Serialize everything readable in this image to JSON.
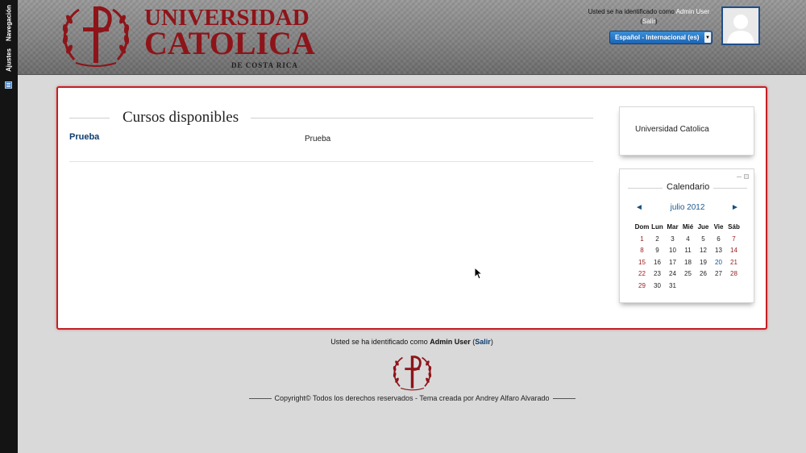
{
  "dock": {
    "nav_label": "Navegación",
    "settings_label": "Ajustes"
  },
  "header": {
    "logo_line1": "UNIVERSIDAD",
    "logo_line2": "CATOLICA",
    "logo_sub": "DE COSTA RICA",
    "login_prefix": "Usted se ha identificado como",
    "user_name": "Admin User",
    "logout_label": "Salir",
    "language": "Español - Internacional (es)"
  },
  "main": {
    "section_title": "Cursos disponibles",
    "courses": [
      {
        "name": "Prueba",
        "summary": "Prueba"
      }
    ]
  },
  "blocks": {
    "university": "Universidad Catolica",
    "calendar": {
      "title": "Calendario",
      "month": "julio 2012",
      "prev": "◄",
      "next": "►",
      "weekdays": [
        "Dom",
        "Lun",
        "Mar",
        "Mié",
        "Jue",
        "Vie",
        "Sáb"
      ],
      "weeks": [
        [
          "1",
          "2",
          "3",
          "4",
          "5",
          "6",
          "7"
        ],
        [
          "8",
          "9",
          "10",
          "11",
          "12",
          "13",
          "14"
        ],
        [
          "15",
          "16",
          "17",
          "18",
          "19",
          "20",
          "21"
        ],
        [
          "22",
          "23",
          "24",
          "25",
          "26",
          "27",
          "28"
        ],
        [
          "29",
          "30",
          "31",
          "",
          "",
          "",
          ""
        ]
      ]
    }
  },
  "footer": {
    "login_prefix": "Usted se ha identificado como",
    "user_name": "Admin User",
    "logout_label": "Salir",
    "copyright": "Copyright© Todos los derechos reservados - Tema creada por Andrey Alfaro Alvarado"
  },
  "colors": {
    "brand_red": "#8e1419",
    "link_blue": "#0d3d6e",
    "frame_red": "#c32026"
  }
}
